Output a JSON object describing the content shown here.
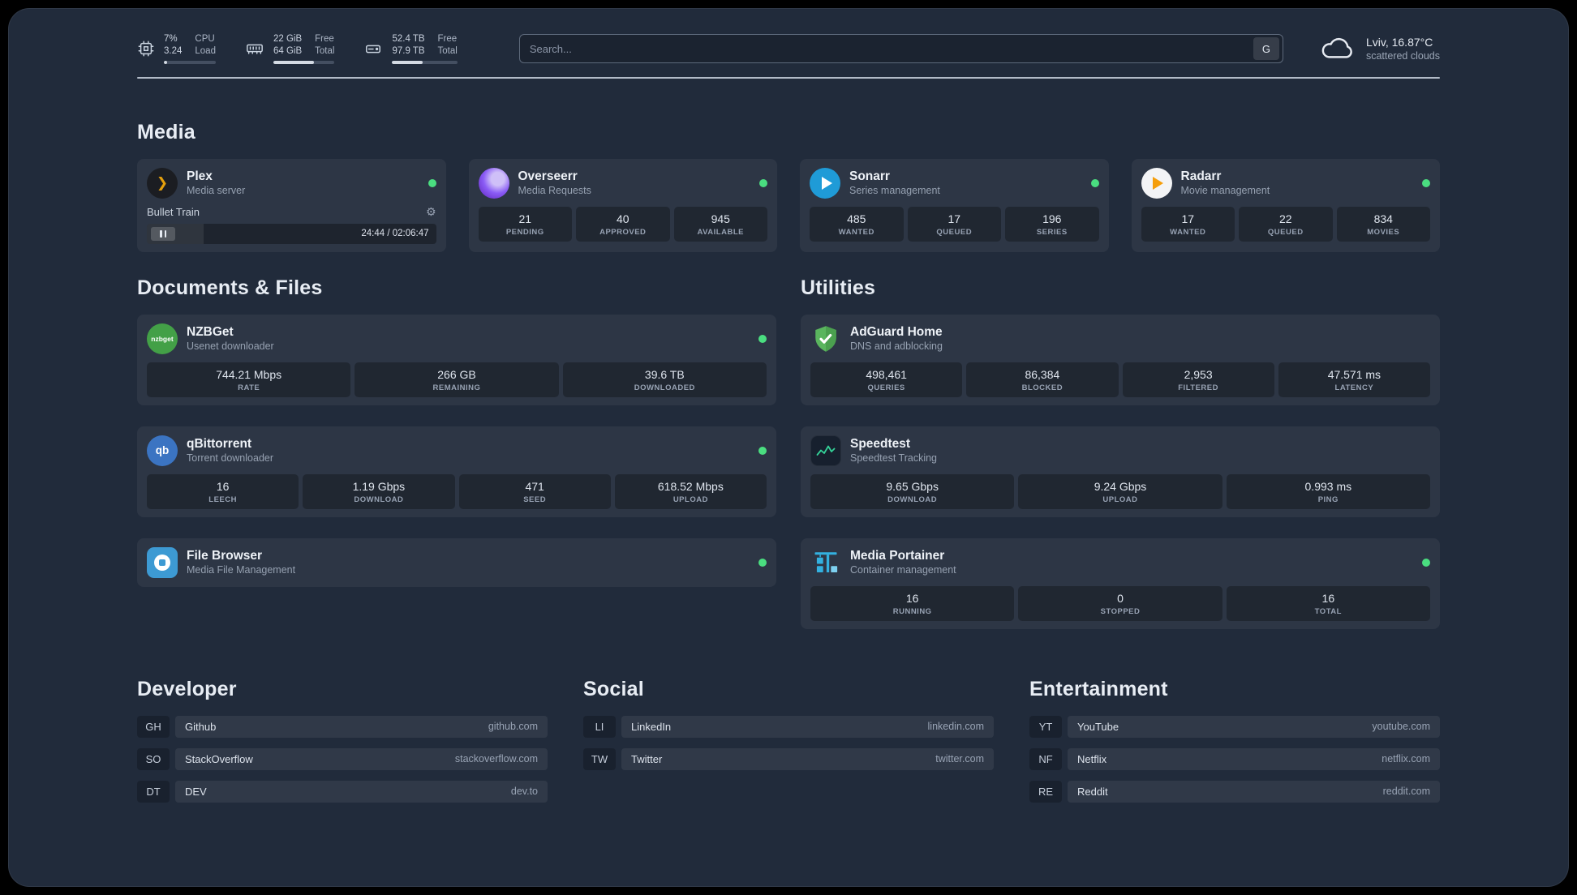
{
  "topbar": {
    "cpu": {
      "v1": "7%",
      "v2": "3.24",
      "l1": "CPU",
      "l2": "Load",
      "progress": 7
    },
    "memory": {
      "v1": "22 GiB",
      "v2": "64 GiB",
      "l1": "Free",
      "l2": "Total",
      "progress": 66
    },
    "disk": {
      "v1": "52.4 TB",
      "v2": "97.9 TB",
      "l1": "Free",
      "l2": "Total",
      "progress": 47
    },
    "search": {
      "placeholder": "Search...",
      "button": "G"
    },
    "weather": {
      "location": "Lviv, 16.87°C",
      "condition": "scattered clouds"
    }
  },
  "sections": {
    "media": "Media",
    "documents": "Documents & Files",
    "utilities": "Utilities",
    "developer": "Developer",
    "social": "Social",
    "entertainment": "Entertainment"
  },
  "services": {
    "plex": {
      "name": "Plex",
      "desc": "Media server",
      "now_playing": "Bullet Train",
      "time": "24:44 / 02:06:47",
      "progress": 19.5
    },
    "overseerr": {
      "name": "Overseerr",
      "desc": "Media Requests",
      "stats": [
        {
          "value": "21",
          "label": "PENDING"
        },
        {
          "value": "40",
          "label": "APPROVED"
        },
        {
          "value": "945",
          "label": "AVAILABLE"
        }
      ]
    },
    "sonarr": {
      "name": "Sonarr",
      "desc": "Series management",
      "stats": [
        {
          "value": "485",
          "label": "WANTED"
        },
        {
          "value": "17",
          "label": "QUEUED"
        },
        {
          "value": "196",
          "label": "SERIES"
        }
      ]
    },
    "radarr": {
      "name": "Radarr",
      "desc": "Movie management",
      "stats": [
        {
          "value": "17",
          "label": "WANTED"
        },
        {
          "value": "22",
          "label": "QUEUED"
        },
        {
          "value": "834",
          "label": "MOVIES"
        }
      ]
    },
    "nzbget": {
      "name": "NZBGet",
      "desc": "Usenet downloader",
      "stats": [
        {
          "value": "744.21 Mbps",
          "label": "RATE"
        },
        {
          "value": "266 GB",
          "label": "REMAINING"
        },
        {
          "value": "39.6 TB",
          "label": "DOWNLOADED"
        }
      ]
    },
    "qbittorrent": {
      "name": "qBittorrent",
      "desc": "Torrent downloader",
      "stats": [
        {
          "value": "16",
          "label": "LEECH"
        },
        {
          "value": "1.19 Gbps",
          "label": "DOWNLOAD"
        },
        {
          "value": "471",
          "label": "SEED"
        },
        {
          "value": "618.52 Mbps",
          "label": "UPLOAD"
        }
      ]
    },
    "filebrowser": {
      "name": "File Browser",
      "desc": "Media File Management"
    },
    "adguard": {
      "name": "AdGuard Home",
      "desc": "DNS and adblocking",
      "stats": [
        {
          "value": "498,461",
          "label": "QUERIES"
        },
        {
          "value": "86,384",
          "label": "BLOCKED"
        },
        {
          "value": "2,953",
          "label": "FILTERED"
        },
        {
          "value": "47.571 ms",
          "label": "LATENCY"
        }
      ]
    },
    "speedtest": {
      "name": "Speedtest",
      "desc": "Speedtest Tracking",
      "stats": [
        {
          "value": "9.65 Gbps",
          "label": "DOWNLOAD"
        },
        {
          "value": "9.24 Gbps",
          "label": "UPLOAD"
        },
        {
          "value": "0.993 ms",
          "label": "PING"
        }
      ]
    },
    "portainer": {
      "name": "Media Portainer",
      "desc": "Container management",
      "stats": [
        {
          "value": "16",
          "label": "RUNNING"
        },
        {
          "value": "0",
          "label": "STOPPED"
        },
        {
          "value": "16",
          "label": "TOTAL"
        }
      ]
    }
  },
  "icon_text": {
    "nzbget": "nzbget",
    "qb": "qb"
  },
  "bookmarks": {
    "developer": [
      {
        "abbr": "GH",
        "name": "Github",
        "url": "github.com"
      },
      {
        "abbr": "SO",
        "name": "StackOverflow",
        "url": "stackoverflow.com"
      },
      {
        "abbr": "DT",
        "name": "DEV",
        "url": "dev.to"
      }
    ],
    "social": [
      {
        "abbr": "LI",
        "name": "LinkedIn",
        "url": "linkedin.com"
      },
      {
        "abbr": "TW",
        "name": "Twitter",
        "url": "twitter.com"
      }
    ],
    "entertainment": [
      {
        "abbr": "YT",
        "name": "YouTube",
        "url": "youtube.com"
      },
      {
        "abbr": "NF",
        "name": "Netflix",
        "url": "netflix.com"
      },
      {
        "abbr": "RE",
        "name": "Reddit",
        "url": "reddit.com"
      }
    ]
  }
}
